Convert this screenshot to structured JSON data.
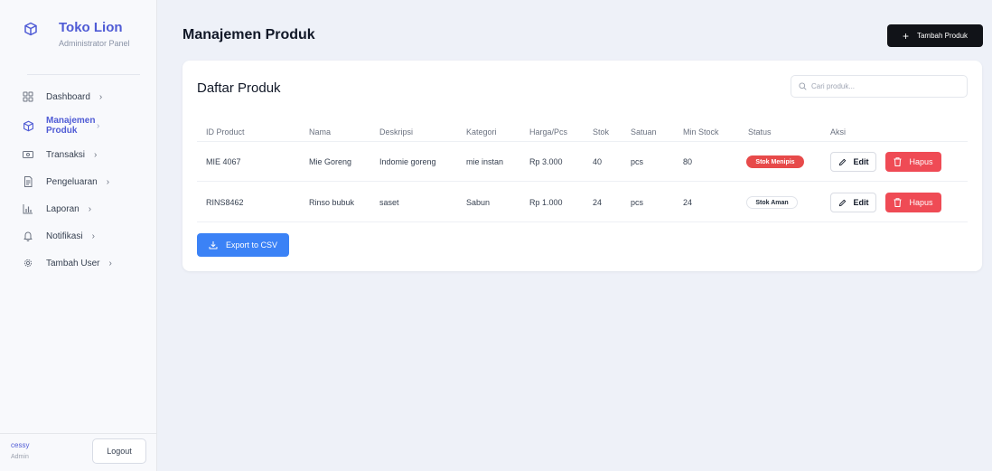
{
  "app": {
    "title": "Toko Lion",
    "subtitle": "Administrator Panel"
  },
  "sidebar": {
    "items": [
      {
        "label": "Dashboard",
        "icon": "grid-icon",
        "active": false
      },
      {
        "label": "Manajemen Produk",
        "icon": "box-icon",
        "active": true
      },
      {
        "label": "Transaksi",
        "icon": "cash-icon",
        "active": false
      },
      {
        "label": "Pengeluaran",
        "icon": "receipt-icon",
        "active": false
      },
      {
        "label": "Laporan",
        "icon": "bar-chart-icon",
        "active": false
      },
      {
        "label": "Notifikasi",
        "icon": "bell-icon",
        "active": false
      },
      {
        "label": "Tambah User",
        "icon": "gear-icon",
        "active": false
      }
    ],
    "chevron": "›"
  },
  "user": {
    "name": "cessy",
    "role": "Admin",
    "logout_label": "Logout"
  },
  "header": {
    "title": "Manajemen Produk",
    "add_label": "Tambah Produk",
    "add_icon": "+"
  },
  "card": {
    "title": "Daftar Produk",
    "search_placeholder": "Cari produk..."
  },
  "table": {
    "headers": [
      "ID Product",
      "Nama",
      "Deskripsi",
      "Kategori",
      "Harga/Pcs",
      "Stok",
      "Satuan",
      "Min Stock",
      "Status",
      "Aksi"
    ],
    "rows": [
      {
        "id": "MIE 4067",
        "nama": "Mie Goreng",
        "deskripsi": "Indomie goreng",
        "kategori": "mie instan",
        "harga": "Rp 3.000",
        "stok": "40",
        "satuan": "pcs",
        "min_stock": "80",
        "status": "Stok Menipis",
        "status_type": "danger"
      },
      {
        "id": "RINS8462",
        "nama": "Rinso bubuk",
        "deskripsi": "saset",
        "kategori": "Sabun",
        "harga": "Rp 1.000",
        "stok": "24",
        "satuan": "pcs",
        "min_stock": "24",
        "status": "Stok Aman",
        "status_type": "safe"
      }
    ],
    "edit_label": "Edit",
    "delete_label": "Hapus"
  },
  "export_label": "Export to CSV",
  "colors": {
    "brand": "#4f5bd5",
    "danger": "#ef4b55",
    "primary": "#3b82f6",
    "dark": "#111318"
  }
}
